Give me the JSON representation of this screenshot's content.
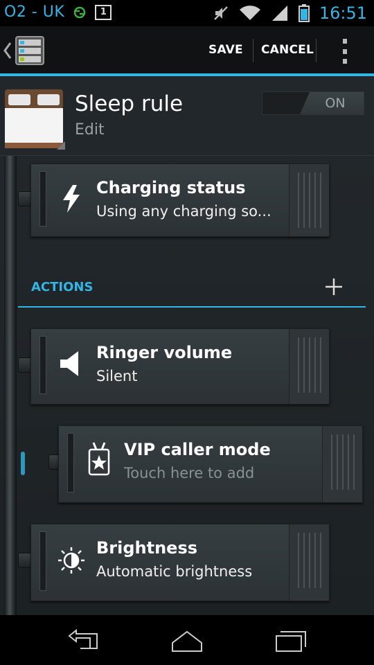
{
  "status_bar": {
    "carrier": "O2 - UK",
    "notification_count": "1",
    "time": "16:51",
    "icons": [
      "sync-icon",
      "notification-icon",
      "mute-icon",
      "wifi-icon",
      "signal-icon",
      "battery-icon"
    ]
  },
  "action_bar": {
    "save_label": "SAVE",
    "cancel_label": "CANCEL"
  },
  "rule": {
    "title": "Sleep rule",
    "subtitle": "Edit",
    "toggle_label": "ON"
  },
  "trigger_card": {
    "title": "Charging status",
    "subtitle": "Using any charging so..."
  },
  "actions_section": {
    "title": "ACTIONS"
  },
  "action_cards": [
    {
      "title": "Ringer volume",
      "subtitle": "Silent",
      "icon": "speaker-icon"
    },
    {
      "title": "VIP caller mode",
      "subtitle": "Touch here to add",
      "icon": "vip-badge-icon"
    },
    {
      "title": "Brightness",
      "subtitle": "Automatic brightness",
      "icon": "brightness-icon"
    }
  ],
  "colors": {
    "accent": "#33b5e5",
    "background": "#1f2427",
    "card": "#353c40"
  }
}
